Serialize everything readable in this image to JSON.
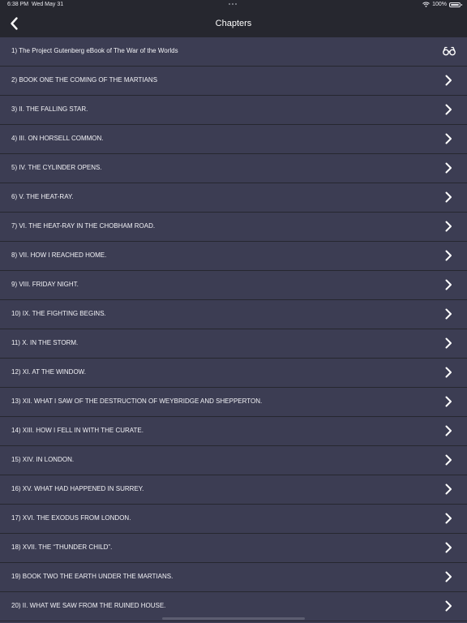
{
  "status": {
    "time": "6:38 PM",
    "date": "Wed May 31",
    "battery": "100%"
  },
  "nav": {
    "title": "Chapters",
    "back_icon": "chevron-left-icon"
  },
  "chapters": [
    {
      "label": "1) The Project Gutenberg eBook of The War of the Worlds",
      "icon": "reading-glasses-icon"
    },
    {
      "label": "2) BOOK ONE THE COMING OF THE MARTIANS",
      "icon": "chevron-right-icon"
    },
    {
      "label": "3) II. THE FALLING STAR.",
      "icon": "chevron-right-icon"
    },
    {
      "label": "4) III. ON HORSELL COMMON.",
      "icon": "chevron-right-icon"
    },
    {
      "label": "5) IV. THE CYLINDER OPENS.",
      "icon": "chevron-right-icon"
    },
    {
      "label": "6) V. THE HEAT-RAY.",
      "icon": "chevron-right-icon"
    },
    {
      "label": "7) VI. THE HEAT-RAY IN THE CHOBHAM ROAD.",
      "icon": "chevron-right-icon"
    },
    {
      "label": "8) VII. HOW I REACHED HOME.",
      "icon": "chevron-right-icon"
    },
    {
      "label": "9) VIII. FRIDAY NIGHT.",
      "icon": "chevron-right-icon"
    },
    {
      "label": "10) IX. THE FIGHTING BEGINS.",
      "icon": "chevron-right-icon"
    },
    {
      "label": "11) X. IN THE STORM.",
      "icon": "chevron-right-icon"
    },
    {
      "label": "12) XI. AT THE WINDOW.",
      "icon": "chevron-right-icon"
    },
    {
      "label": "13) XII. WHAT I SAW OF THE DESTRUCTION OF WEYBRIDGE AND SHEPPERTON.",
      "icon": "chevron-right-icon"
    },
    {
      "label": "14) XIII. HOW I FELL IN WITH THE CURATE.",
      "icon": "chevron-right-icon"
    },
    {
      "label": "15) XIV. IN LONDON.",
      "icon": "chevron-right-icon"
    },
    {
      "label": "16) XV. WHAT HAD HAPPENED IN SURREY.",
      "icon": "chevron-right-icon"
    },
    {
      "label": "17) XVI. THE EXODUS FROM LONDON.",
      "icon": "chevron-right-icon"
    },
    {
      "label": "18) XVII. THE “THUNDER CHILD”.",
      "icon": "chevron-right-icon"
    },
    {
      "label": "19) BOOK TWO THE EARTH UNDER THE MARTIANS.",
      "icon": "chevron-right-icon"
    },
    {
      "label": "20) II. WHAT WE SAW FROM THE RUINED HOUSE.",
      "icon": "chevron-right-icon"
    }
  ],
  "colors": {
    "background": "#3c3d53",
    "bar": "#26272f",
    "text": "#ffffff"
  }
}
